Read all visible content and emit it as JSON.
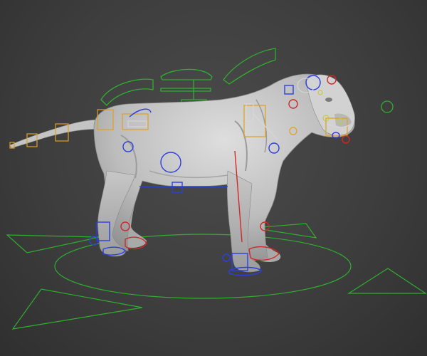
{
  "viewport": {
    "background_color": "#3f3f3f",
    "model": {
      "subject": "lioness",
      "shading": "grey-clay",
      "surface_color": "#c9c9c9"
    },
    "rig_colors": {
      "main_controls": "#2fae2f",
      "fk_controls": "#e0a020",
      "left_side_controls": "#2b3fe0",
      "right_side_controls": "#d02828",
      "pose_controls": "#d8d8d8",
      "face_controls": "#c8c828"
    }
  }
}
